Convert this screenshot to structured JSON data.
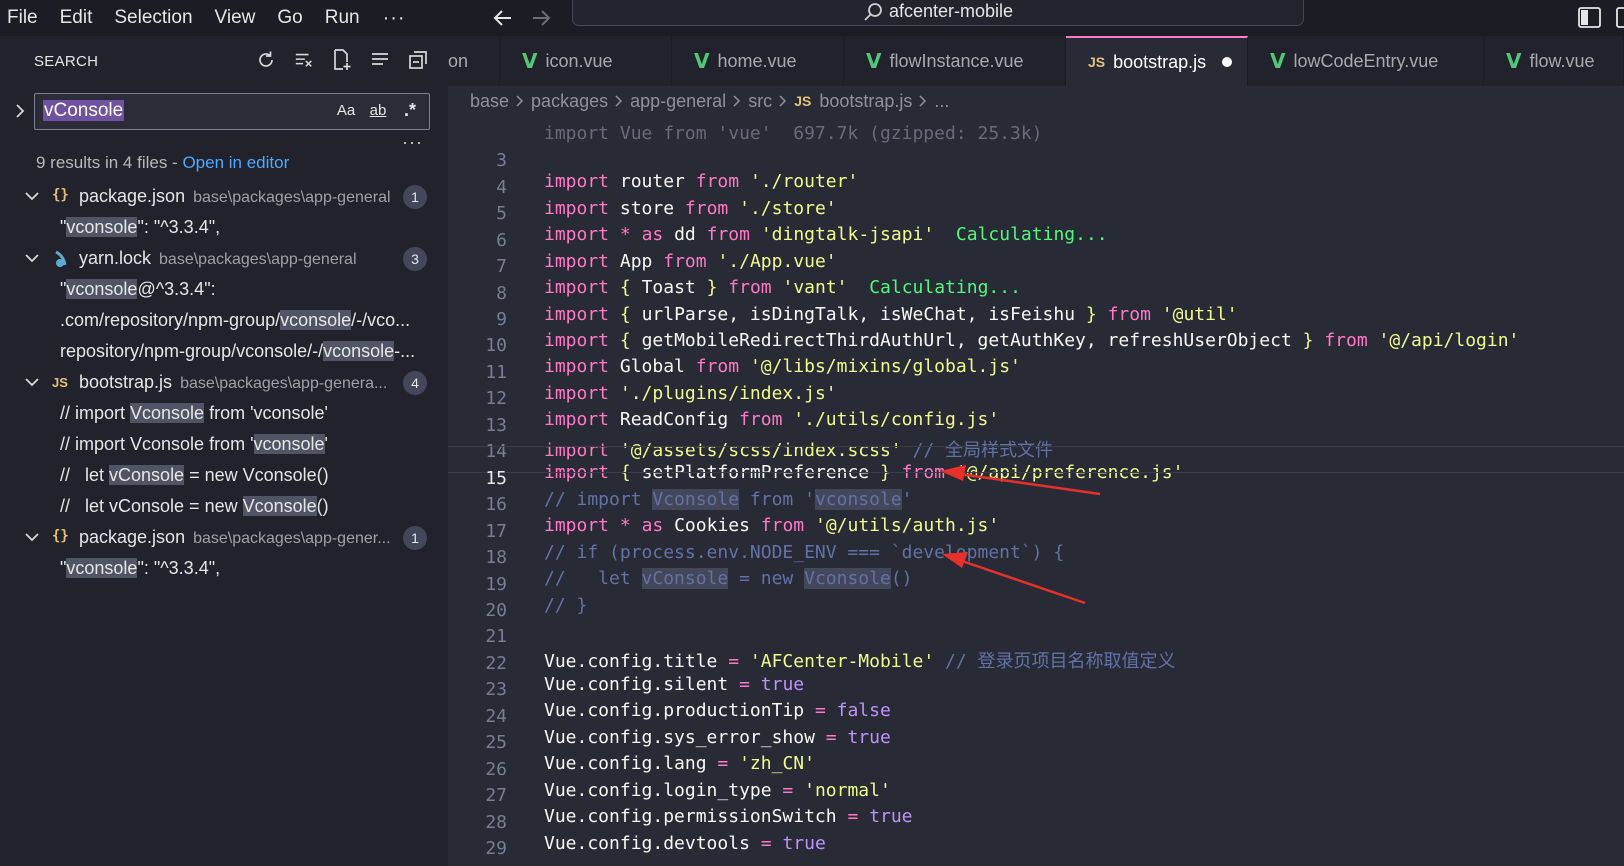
{
  "menu": {
    "file": "File",
    "edit": "Edit",
    "selection": "Selection",
    "view": "View",
    "go": "Go",
    "run": "Run",
    "more": "···"
  },
  "command_center": {
    "title": "afcenter-mobile",
    "icon": "search-icon"
  },
  "sidebar": {
    "title": "SEARCH",
    "search_value": "vConsole",
    "options": {
      "match_case": "Aa",
      "whole_word": "ab",
      "regex": ".*"
    },
    "summary_text": "9 results in 4 files - ",
    "open_in_editor": "Open in editor",
    "results": [
      {
        "icon": "{}",
        "name": "package.json",
        "path": "base\\packages\\app-general",
        "count": "1",
        "matches": [
          {
            "pre": "\"",
            "hit": "vconsole",
            "post": "\": \"^3.3.4\","
          }
        ]
      },
      {
        "icon": "yarn-icon",
        "name": "yarn.lock",
        "path": "base\\packages\\app-general",
        "count": "3",
        "matches": [
          {
            "pre": "\"",
            "hit": "vconsole",
            "post": "@^3.3.4\":"
          },
          {
            "pre": ".com/repository/npm-group/",
            "hit": "vconsole",
            "post": "/-/vco..."
          },
          {
            "pre": "repository/npm-group/vconsole/-/",
            "hit": "vconsole",
            "post": "-..."
          }
        ]
      },
      {
        "icon": "JS",
        "name": "bootstrap.js",
        "path": "base\\packages\\app-genera...",
        "count": "4",
        "matches": [
          {
            "pre": "// import ",
            "hit": "Vconsole",
            "post": " from 'vconsole'"
          },
          {
            "pre": "// import Vconsole from '",
            "hit": "vconsole",
            "post": "'"
          },
          {
            "pre": "//   let ",
            "hit": "vConsole",
            "post": " = new Vconsole()"
          },
          {
            "pre": "//   let vConsole = new ",
            "hit": "Vconsole",
            "post": "()"
          }
        ]
      },
      {
        "icon": "{}",
        "name": "package.json",
        "path": "base\\packages\\app-gener...",
        "count": "1",
        "matches": [
          {
            "pre": "\"",
            "hit": "vconsole",
            "post": "\": \"^3.3.4\","
          }
        ]
      }
    ]
  },
  "tabs": [
    {
      "label": "on",
      "type": "partial"
    },
    {
      "label": "icon.vue",
      "type": "vue"
    },
    {
      "label": "home.vue",
      "type": "vue"
    },
    {
      "label": "flowInstance.vue",
      "type": "vue"
    },
    {
      "label": "bootstrap.js",
      "type": "js",
      "active": true,
      "modified": true
    },
    {
      "label": "lowCodeEntry.vue",
      "type": "vue"
    },
    {
      "label": "flow.vue",
      "type": "vue"
    }
  ],
  "breadcrumb": {
    "parts": [
      "base",
      "packages",
      "app-general",
      "src"
    ],
    "file_icon": "JS",
    "file": "bootstrap.js",
    "tail": "..."
  },
  "code": {
    "partial_top": "import Vue from 'vue'  697.7k (gzipped: 25.3k)",
    "lines": [
      {
        "n": "3"
      },
      {
        "n": "4"
      },
      {
        "n": "5"
      },
      {
        "n": "6"
      },
      {
        "n": "7"
      },
      {
        "n": "8"
      },
      {
        "n": "9"
      },
      {
        "n": "10"
      },
      {
        "n": "11"
      },
      {
        "n": "12"
      },
      {
        "n": "13"
      },
      {
        "n": "14"
      },
      {
        "n": "15"
      },
      {
        "n": "16"
      },
      {
        "n": "17"
      },
      {
        "n": "18"
      },
      {
        "n": "19"
      },
      {
        "n": "20"
      },
      {
        "n": "21"
      },
      {
        "n": "22"
      },
      {
        "n": "23"
      },
      {
        "n": "24"
      },
      {
        "n": "25"
      },
      {
        "n": "26"
      },
      {
        "n": "27"
      },
      {
        "n": "28"
      },
      {
        "n": "29"
      }
    ],
    "t": {
      "import": "import",
      "from": "from",
      "as": "as",
      "star": "*",
      "router": "router",
      "router_path": "'./router'",
      "store": "store",
      "store_path": "'./store'",
      "dd": "dd",
      "dingtalk": "'dingtalk-jsapi'",
      "calc": "Calculating...",
      "app": "App",
      "app_path": "'./App.vue'",
      "toast": "Toast",
      "vant": "'vant'",
      "util_names": "urlParse, isDingTalk, isWeChat, isFeishu",
      "util_path": "'@util'",
      "login_names": "getMobileRedirectThirdAuthUrl, getAuthKey, refreshUserObject",
      "login_path": "'@/api/login'",
      "global": "Global",
      "global_path": "'@/libs/mixins/global.js'",
      "plugins_path": "'./plugins/index.js'",
      "readconfig": "ReadConfig",
      "config_path": "'./utils/config.js'",
      "scss_path": "'@/assets/scss/index.scss'",
      "scss_comment": "// 全局样式文件",
      "setpref": "setPlatformPreference",
      "pref_path": "'@/api/preference.js'",
      "c15_a": "// import ",
      "c15_hit1": "Vconsole",
      "c15_b": " from '",
      "c15_hit2": "vconsole",
      "c15_c": "'",
      "cookies": "Cookies",
      "auth_path": "'@/utils/auth.js'",
      "c17": "// if (process.env.NODE_ENV === `development`) {",
      "c18_a": "//   let ",
      "c18_hit1": "vConsole",
      "c18_b": " = new ",
      "c18_hit2": "Vconsole",
      "c18_c": "()",
      "c19": "// }",
      "title_lhs": "Vue.config.title",
      "title_val": "'AFCenter-Mobile'",
      "title_comment": "// 登录页项目名称取值定义",
      "silent_lhs": "Vue.config.silent",
      "prodtip_lhs": "Vue.config.productionTip",
      "syserr_lhs": "Vue.config.sys_error_show",
      "lang_lhs": "Vue.config.lang",
      "lang_val": "'zh_CN'",
      "login_lhs": "Vue.config.login_type",
      "login_val": "'normal'",
      "perm_lhs": "Vue.config.permissionSwitch",
      "devtools_lhs": "Vue.config.devtools",
      "eq": "=",
      "true": "true",
      "false": "false",
      "lb": "{",
      "rb": "}"
    }
  },
  "colors": {
    "accent": "#ff79c6",
    "annotation_arrow": "#e8302a"
  }
}
